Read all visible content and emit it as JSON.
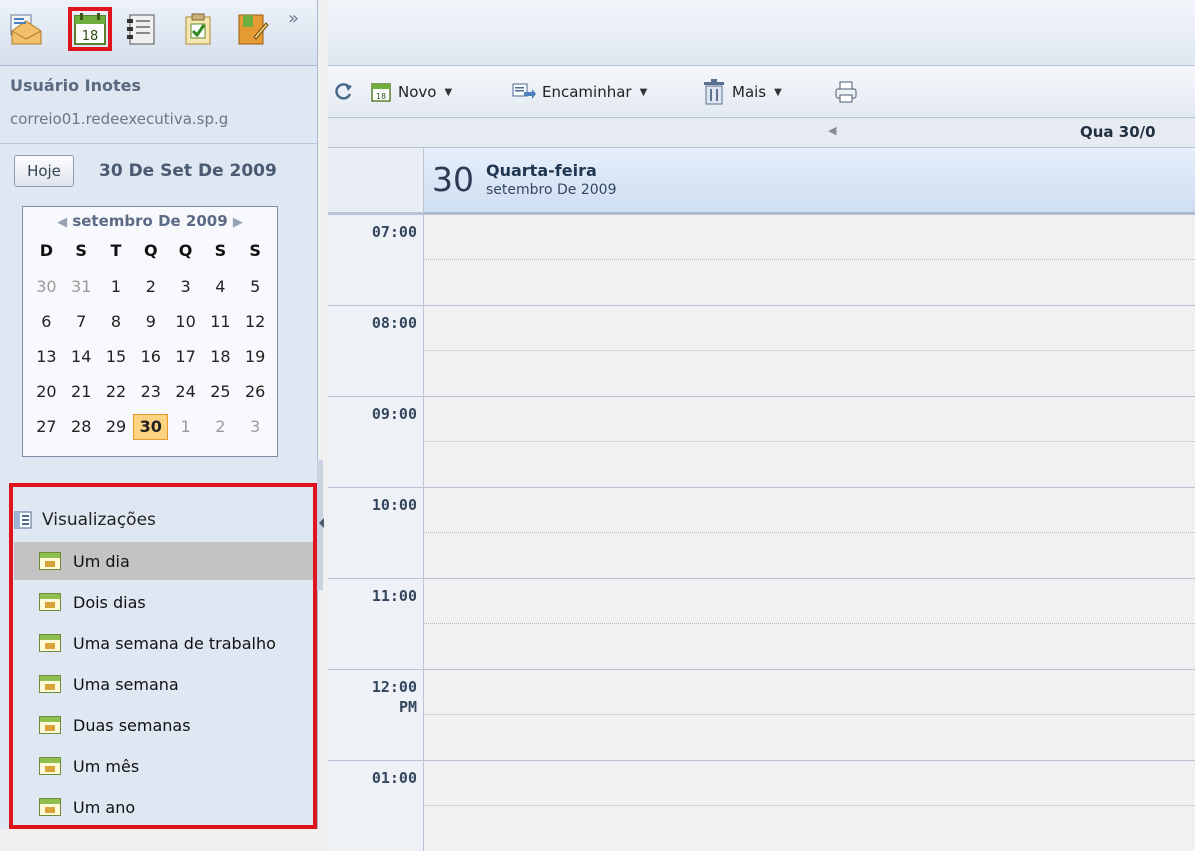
{
  "app_toolbar": {
    "icons": [
      "mail-icon",
      "calendar-icon",
      "contacts-icon",
      "tasks-icon",
      "notebook-icon"
    ],
    "selected": "calendar-icon",
    "calendar_day": "18",
    "more": "»"
  },
  "user": {
    "name": "Usuário Inotes",
    "server": "correio01.redeexecutiva.sp.g"
  },
  "datebar": {
    "today_label": "Hoje",
    "date": "30 De Set De 2009"
  },
  "mini_calendar": {
    "title": "setembro De 2009",
    "weekdays": [
      "D",
      "S",
      "T",
      "Q",
      "Q",
      "S",
      "S"
    ],
    "weeks": [
      [
        "30",
        "31",
        "1",
        "2",
        "3",
        "4",
        "5"
      ],
      [
        "6",
        "7",
        "8",
        "9",
        "10",
        "11",
        "12"
      ],
      [
        "13",
        "14",
        "15",
        "16",
        "17",
        "18",
        "19"
      ],
      [
        "20",
        "21",
        "22",
        "23",
        "24",
        "25",
        "26"
      ],
      [
        "27",
        "28",
        "29",
        "30",
        "1",
        "2",
        "3"
      ]
    ],
    "today": "30"
  },
  "views": {
    "header": "Visualizações",
    "items": [
      {
        "label": "Um dia",
        "selected": true
      },
      {
        "label": "Dois dias"
      },
      {
        "label": "Uma semana de trabalho"
      },
      {
        "label": "Uma semana"
      },
      {
        "label": "Duas semanas"
      },
      {
        "label": "Um mês"
      },
      {
        "label": "Um ano"
      }
    ]
  },
  "toolbar": {
    "new_label": "Novo",
    "forward_label": "Encaminhar",
    "more_label": "Mais",
    "new_icon_day": "18"
  },
  "nav": {
    "current": "Qua 30/0"
  },
  "day_header": {
    "day_number": "30",
    "weekday": "Quarta-feira",
    "month_year": "setembro De 2009"
  },
  "hours": [
    "07:00",
    "08:00",
    "09:00",
    "10:00",
    "11:00",
    "12:00",
    "01:00"
  ],
  "noon_suffix": "PM",
  "colors": {
    "selection_outline": "#e0141c",
    "today_highlight": "#fcd481"
  }
}
